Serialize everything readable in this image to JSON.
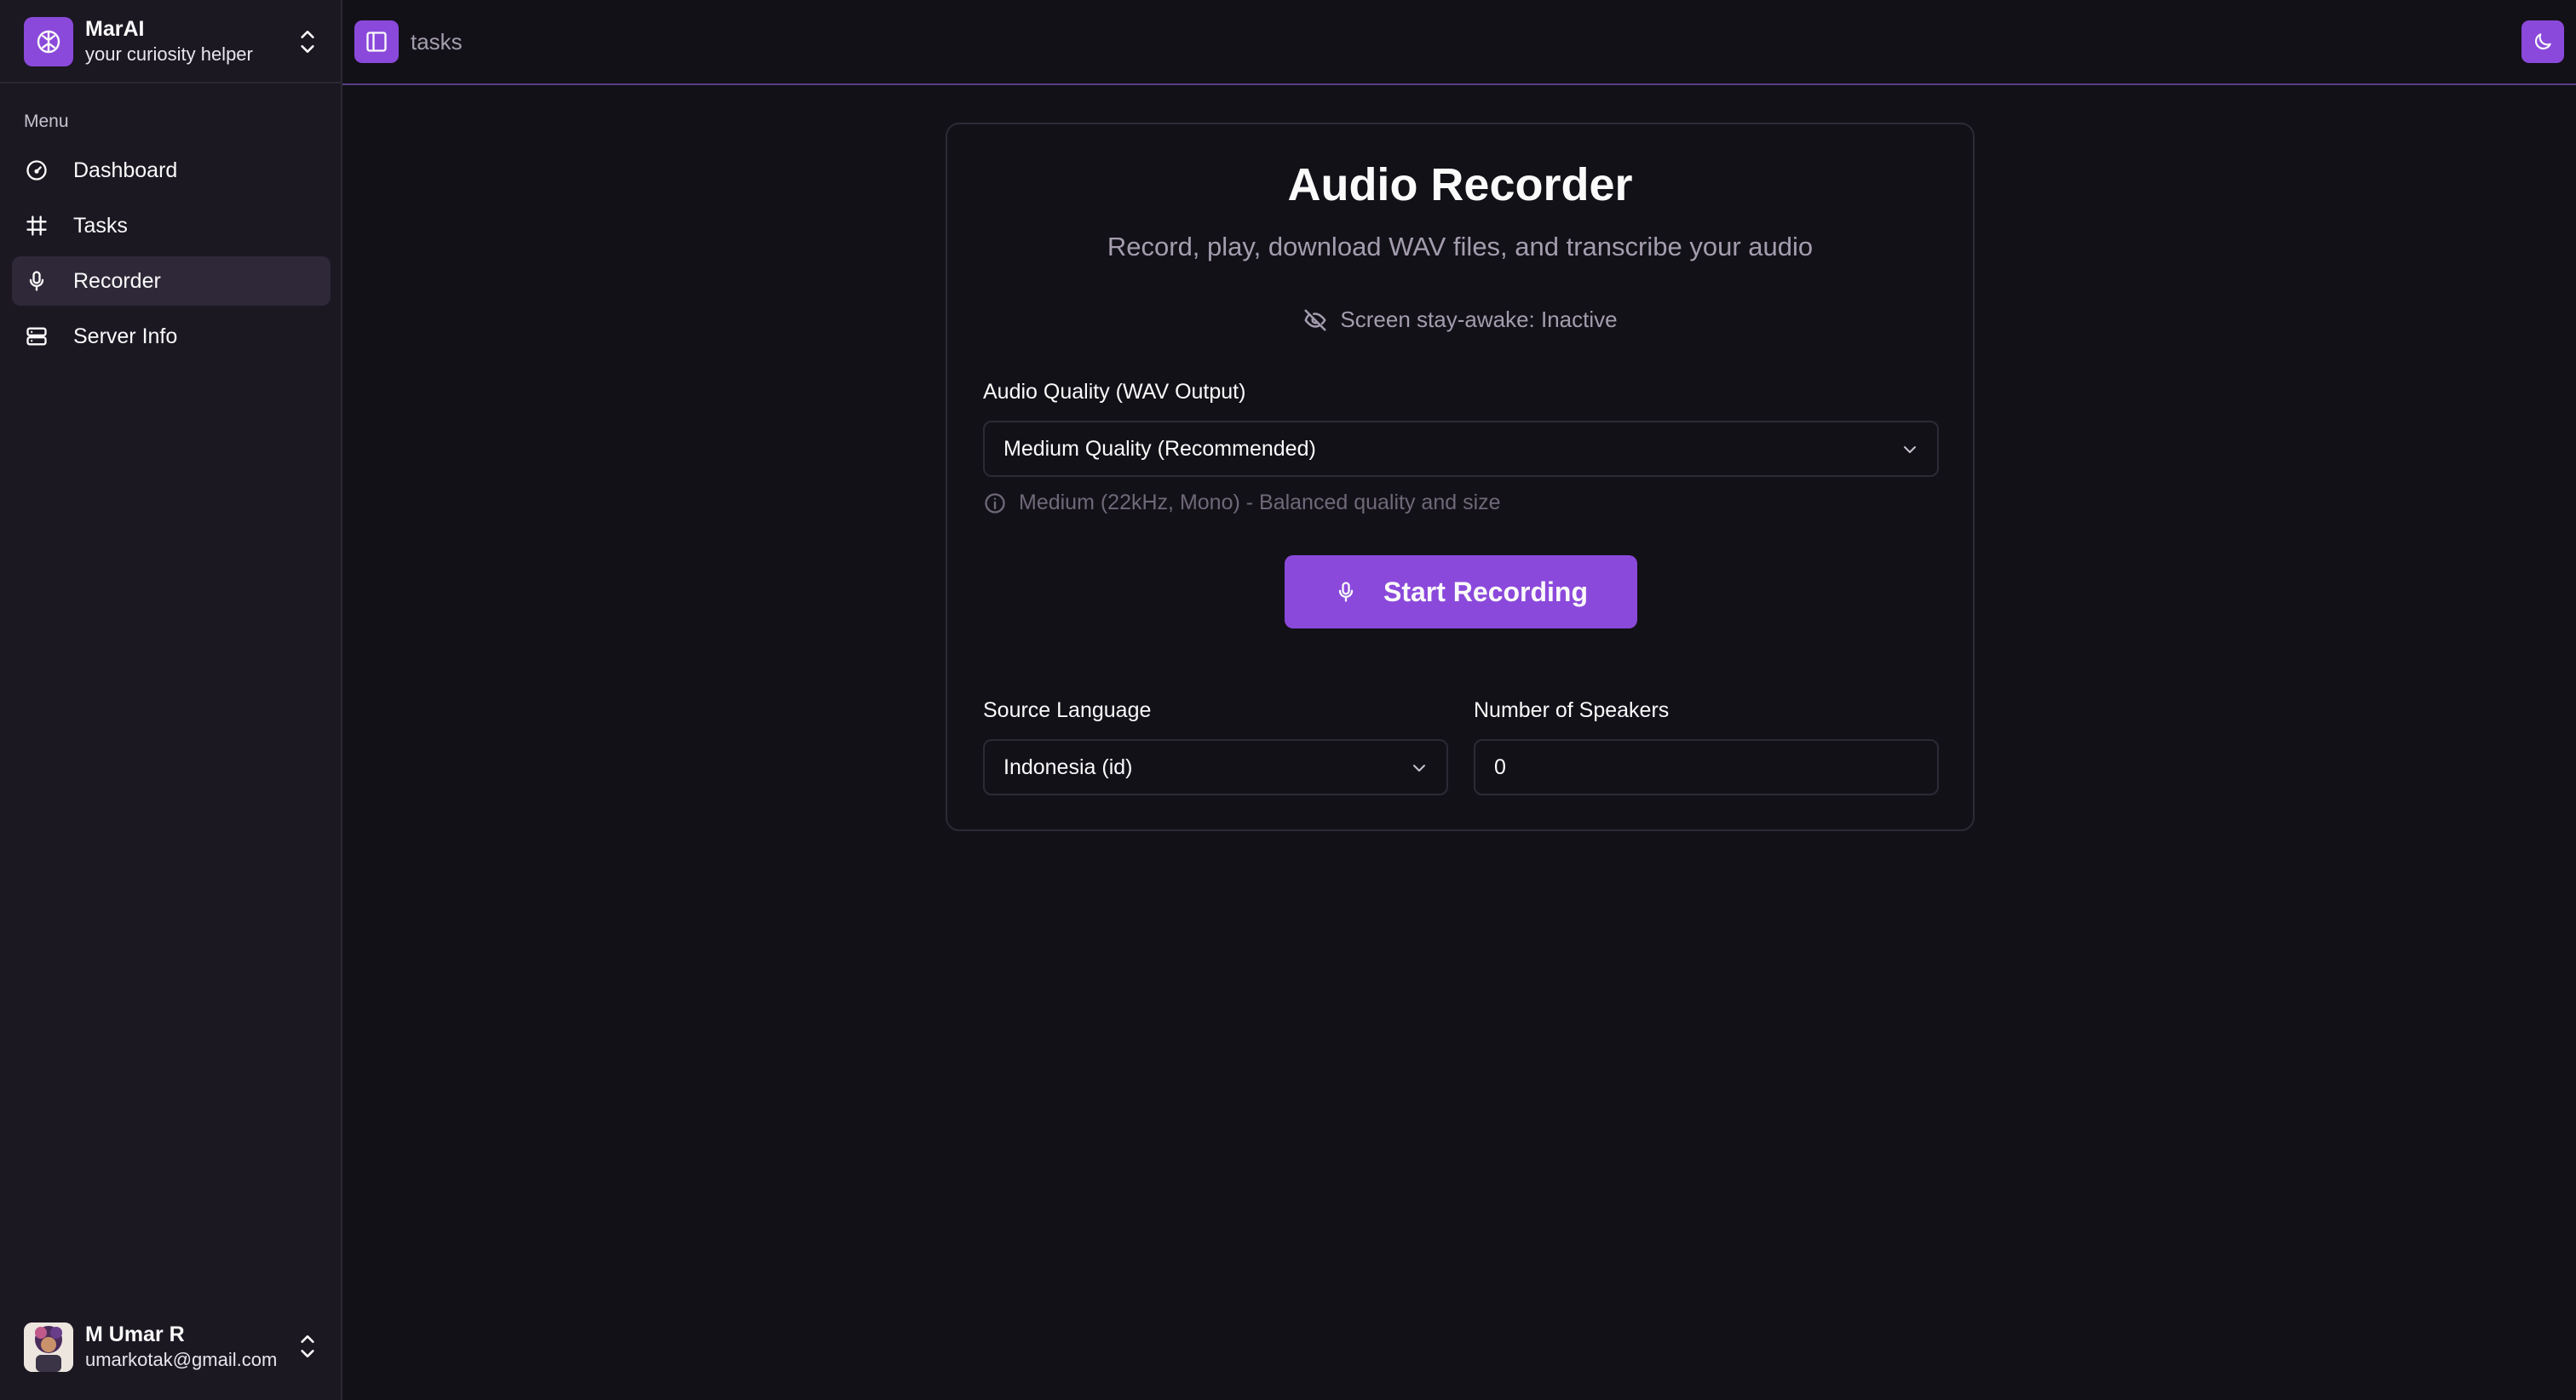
{
  "sidebar": {
    "brand_name": "MarAI",
    "brand_tagline": "your curiosity helper",
    "menu_label": "Menu",
    "items": [
      {
        "label": "Dashboard",
        "icon": "gauge-icon",
        "active": false
      },
      {
        "label": "Tasks",
        "icon": "hash-icon",
        "active": false
      },
      {
        "label": "Recorder",
        "icon": "mic-icon",
        "active": true
      },
      {
        "label": "Server Info",
        "icon": "server-icon",
        "active": false
      }
    ],
    "user": {
      "name": "M Umar R",
      "email": "umarkotak@gmail.com"
    }
  },
  "header": {
    "breadcrumb": "tasks"
  },
  "recorder": {
    "title": "Audio Recorder",
    "subtitle": "Record, play, download WAV files, and transcribe your audio",
    "stay_awake": "Screen stay-awake: Inactive",
    "quality_label": "Audio Quality (WAV Output)",
    "quality_value": "Medium Quality (Recommended)",
    "quality_hint": "Medium (22kHz, Mono) - Balanced quality and size",
    "start_label": "Start Recording",
    "language_label": "Source Language",
    "language_value": "Indonesia (id)",
    "speakers_label": "Number of Speakers",
    "speakers_value": "0"
  },
  "colors": {
    "accent": "#8b49db",
    "background": "#131118",
    "sidebar": "#1b1822",
    "muted_text": "#a49dae"
  }
}
